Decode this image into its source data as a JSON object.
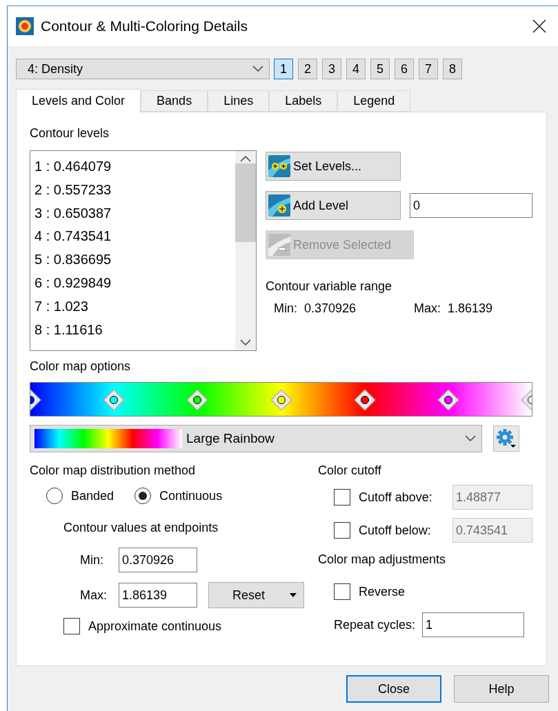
{
  "window": {
    "title": "Contour & Multi-Coloring Details"
  },
  "variable": {
    "value": "4: Density"
  },
  "map_numbers": [
    {
      "label": "1",
      "selected": true
    },
    {
      "label": "2",
      "selected": false
    },
    {
      "label": "3",
      "selected": false
    },
    {
      "label": "4",
      "selected": false
    },
    {
      "label": "5",
      "selected": false
    },
    {
      "label": "6",
      "selected": false
    },
    {
      "label": "7",
      "selected": false
    },
    {
      "label": "8",
      "selected": false
    }
  ],
  "tabs": [
    {
      "label": "Levels and Color",
      "selected": true
    },
    {
      "label": "Bands",
      "selected": false
    },
    {
      "label": "Lines",
      "selected": false
    },
    {
      "label": "Labels",
      "selected": false
    },
    {
      "label": "Legend",
      "selected": false
    }
  ],
  "contour_levels": {
    "title": "Contour levels",
    "items": [
      "1 : 0.464079",
      "2 : 0.557233",
      "3 : 0.650387",
      "4 : 0.743541",
      "5 : 0.836695",
      "6 : 0.929849",
      "7 : 1.023",
      "8 : 1.11616"
    ]
  },
  "level_buttons": [
    {
      "kind": "set",
      "label": "Set Levels...",
      "disabled": false
    },
    {
      "kind": "add",
      "label": "Add Level",
      "disabled": false,
      "value": "0"
    },
    {
      "kind": "remove",
      "label": "Remove Selected",
      "disabled": true
    }
  ],
  "variable_range": {
    "title": "Contour variable range",
    "min_label": "Min:",
    "min": "0.370926",
    "max_label": "Max:",
    "max": "1.86139"
  },
  "color_map": {
    "title": "Color map options",
    "name": "Large Rainbow",
    "markers": [
      {
        "color": "#0000ff"
      },
      {
        "color": "#00ffff"
      },
      {
        "color": "#00ff00"
      },
      {
        "color": "#ffff00"
      },
      {
        "color": "#ff0000"
      },
      {
        "color": "#ff00ff"
      },
      {
        "color": "#ffffff"
      }
    ]
  },
  "distribution": {
    "title": "Color map distribution method",
    "options": [
      {
        "label": "Banded",
        "selected": false
      },
      {
        "label": "Continuous",
        "selected": true
      }
    ],
    "endpoints_title": "Contour values at endpoints",
    "min_label": "Min:",
    "min": "0.370926",
    "max_label": "Max:",
    "max": "1.86139",
    "reset": "Reset",
    "approximate": {
      "label": "Approximate continuous",
      "checked": false
    }
  },
  "cutoff": {
    "title": "Color cutoff",
    "items": [
      {
        "label": "Cutoff above:",
        "checked": false,
        "value": "1.48877"
      },
      {
        "label": "Cutoff below:",
        "checked": false,
        "value": "0.743541"
      }
    ]
  },
  "adjustments": {
    "title": "Color map adjustments",
    "reverse": {
      "label": "Reverse",
      "checked": false
    },
    "repeat_label": "Repeat cycles:",
    "repeat": "1"
  },
  "buttons": [
    {
      "label": "Close",
      "selected": true
    },
    {
      "label": "Help",
      "selected": false
    }
  ]
}
